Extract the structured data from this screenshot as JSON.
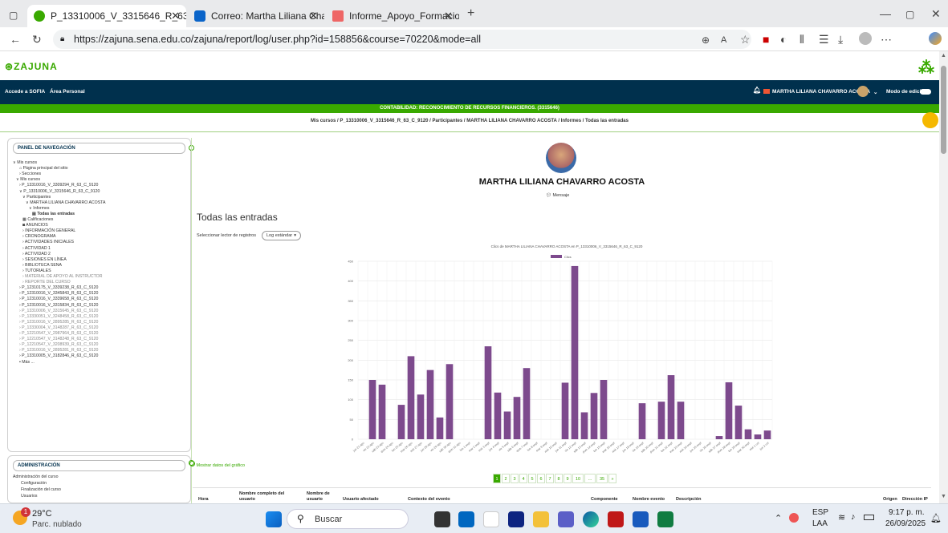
{
  "browser": {
    "tabs": [
      {
        "title": "P_13310006_V_3315646_R_63_C_"
      },
      {
        "title": "Correo: Martha Liliana Chavarro A"
      },
      {
        "title": "Informe_Apoyo_Formacion (54)se"
      }
    ],
    "url": "https://zajuna.sena.edu.co/zajuna/report/log/user.php?id=158856&course=70220&mode=all"
  },
  "site": {
    "logo_text": "ZAJUNA",
    "nav_links": [
      "Accede a SOFIA",
      "Área Personal"
    ],
    "user_name": "MARTHA LILIANA CHAVARRO ACOSTA",
    "edit_mode_label": "Modo de edición",
    "course_banner": "CONTABILIDAD: RECONOCIMIENTO DE RECURSOS FINANCIEROS. (3315646)",
    "breadcrumb": [
      "Mis cursos",
      "P_13310006_V_3315646_R_63_C_9120",
      "Participantes",
      "MARTHA LILIANA CHAVARRO ACOSTA",
      "Informes",
      "Todas las entradas"
    ]
  },
  "sidebar": {
    "panel_title": "PANEL DE NAVEGACIÓN",
    "items": [
      "Mis cursos",
      "Página principal del sitio",
      "Secciones",
      "Mis cursos",
      "P_13310016_V_3309294_R_63_C_9120",
      "P_13310006_V_3315646_R_63_C_9120",
      "Participantes",
      "MARTHA LILIANA CHAVARRO ACOSTA",
      "Informes",
      "Todas las entradas",
      "Calificaciones",
      "ANUNCIOS",
      "INFORMACIÓN GENERAL",
      "CRONOGRAMA",
      "ACTIVIDADES INICIALES",
      "ACTIVIDAD 1",
      "ACTIVIDAD 2",
      "SESIONES EN LÍNEA",
      "BIBLIOTECA SENA",
      "TUTORIALES",
      "MATERIAL DE APOYO AL INSTRUCTOR",
      "REPORTE DEL CURSO",
      "P_12310175_V_3339238_R_63_C_9120",
      "P_12310016_V_3345843_R_63_C_9120",
      "P_12310016_V_3339658_R_63_C_9120",
      "P_12310016_V_3315834_R_63_C_9120",
      "P_13310006_V_3315645_R_63_C_9120",
      "P_13330051_V_3248458_R_63_C_9120",
      "P_12310016_V_2895285_R_63_C_9120",
      "P_13330004_V_3148287_R_63_C_9120",
      "P_12210547_V_2987964_R_63_C_9120",
      "P_12210547_V_3148248_R_63_C_9120",
      "P_12210547_V_3208939_R_63_C_9120",
      "P_12310016_V_2895281_R_63_C_9120",
      "P_13310005_V_3182846_R_63_C_9120",
      "Más ..."
    ],
    "admin_title": "ADMINISTRACIÓN",
    "admin_items": [
      "Administración del curso",
      "Configuración",
      "Finalización del curso",
      "Usuarios"
    ]
  },
  "main": {
    "user_full_name": "MARTHA LILIANA CHAVARRO ACOSTA",
    "message_label": "Mensaje",
    "page_heading": "Todas las entradas",
    "log_reader_label": "Seleccionar lector de registros",
    "log_reader_value": "Log estándar",
    "show_data_link": "Mostrar datos del gráfico",
    "pagination": [
      "1",
      "2",
      "3",
      "4",
      "5",
      "6",
      "7",
      "8",
      "9",
      "10",
      "...",
      "35",
      "»"
    ],
    "table_headers": [
      "Hora",
      "Nombre completo del usuario",
      "Nombre de usuario",
      "Usuario afectado",
      "Contexto del evento",
      "Componente",
      "Nombre evento",
      "Descripción",
      "Origen",
      "Dirección IP"
    ]
  },
  "chart_data": {
    "type": "bar",
    "title": "Clics de MARTHA LILIANA CHAVARRO ACOSTA  en P_13310006_V_3315646_R_63_C_9120",
    "legend": [
      "Clics"
    ],
    "series": [
      {
        "name": "Clics",
        "values": [
          0,
          150,
          138,
          0,
          87,
          210,
          113,
          175,
          55,
          190,
          0,
          0,
          0,
          235,
          118,
          70,
          107,
          180,
          0,
          0,
          0,
          143,
          438,
          68,
          117,
          150,
          0,
          0,
          0,
          91,
          0,
          95,
          162,
          95,
          0,
          0,
          0,
          8,
          144,
          85,
          25,
          12,
          22
        ]
      }
    ],
    "categories": [
      "jue 21 ago",
      "vie 22 ago",
      "sáb 23 ago",
      "dom 24 ago",
      "lun 25 ago",
      "mar 26 ago",
      "mié 27 ago",
      "jue 28 ago",
      "vie 29 ago",
      "sáb 30 ago",
      "dom 31 ago",
      "lun 1 sept",
      "mar 2 sept",
      "mié 3 sept",
      "jue 4 sept",
      "vie 5 sept",
      "sáb 6 sept",
      "dom 7 sept",
      "lun 8 sept",
      "mar 9 sept",
      "mié 10 sept",
      "jue 11 sept",
      "vie 12 sept",
      "sáb 13 sept",
      "dom 14 sept",
      "lun 15 sept",
      "mar 16 sept",
      "mié 17 sept",
      "jue 18 sept",
      "vie 19 sept",
      "sáb 20 sept",
      "dom 21 sept",
      "lun 22 sept",
      "mar 23 sept",
      "mié 24 sept",
      "jue 25 sept",
      "vie 26 sept",
      "sáb 27 sept",
      "dom 28 sept",
      "lun 29 sept",
      "mar 30 sept",
      "mié 1 oct",
      "jue 2 oct"
    ],
    "ylim": [
      0,
      450
    ],
    "yticks": [
      0,
      50,
      100,
      150,
      200,
      250,
      300,
      350,
      400,
      450
    ],
    "bar_color": "#7d4a8d",
    "grid": true
  },
  "taskbar": {
    "weather_temp": "29°C",
    "weather_desc": "Parc. nublado",
    "search_placeholder": "Buscar",
    "lang_top": "ESP",
    "lang_bottom": "LAA",
    "time": "9:17 p. m.",
    "date": "26/09/2025",
    "notification_count": "1"
  },
  "colors": {
    "navbar": "#00304d",
    "green": "#39a900",
    "bar": "#7d4a8d"
  }
}
